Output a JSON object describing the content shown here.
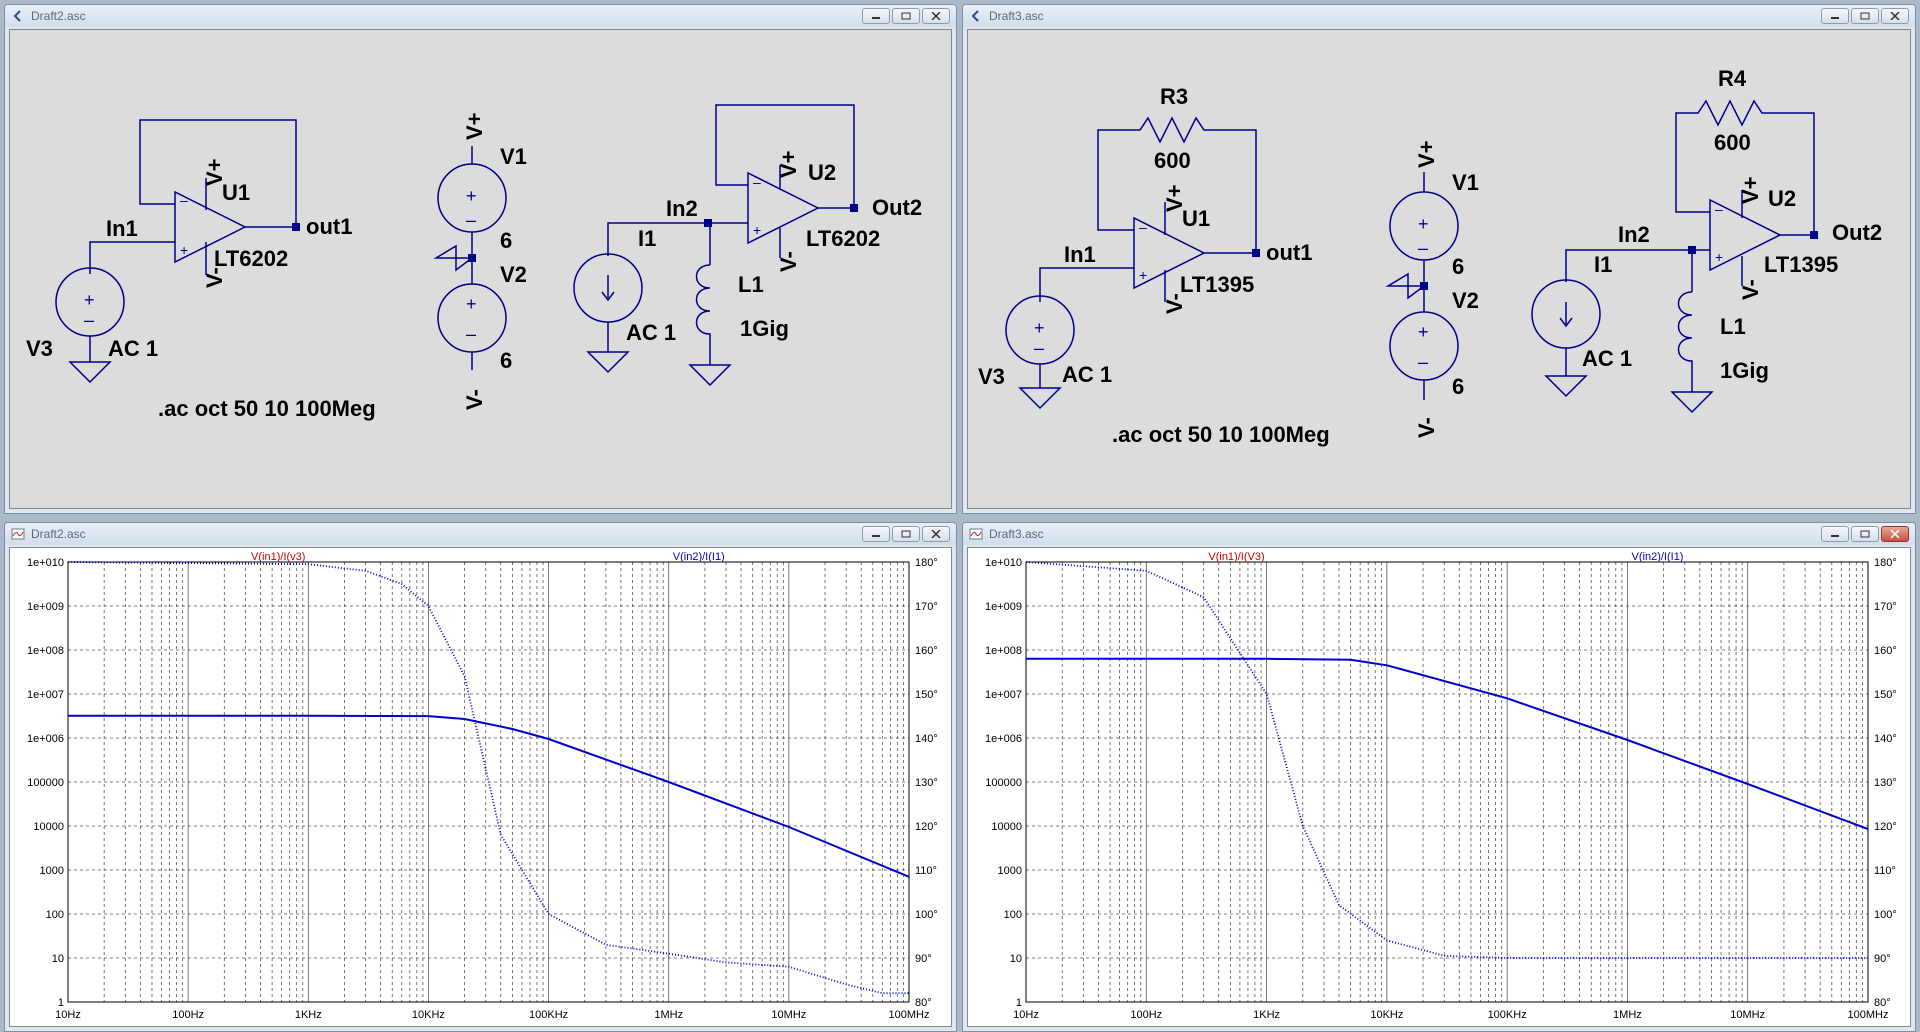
{
  "windows": {
    "draft2_schematic": {
      "title": "Draft2.asc"
    },
    "draft3_schematic": {
      "title": "Draft3.asc"
    },
    "draft2_plot": {
      "title": "Draft2.asc"
    },
    "draft3_plot": {
      "title": "Draft3.asc"
    }
  },
  "schematic2": {
    "u1_name": "U1",
    "u1_model": "LT6202",
    "u2_name": "U2",
    "u2_model": "LT6202",
    "in1": "In1",
    "out1": "out1",
    "in2": "In2",
    "out2": "Out2",
    "v1": "V1",
    "v2": "V2",
    "v3": "V3",
    "v1_value": "6",
    "v2_value": "6",
    "vplus": "V+",
    "vminus": "V-",
    "ac": "AC 1",
    "i1": "I1",
    "l1": "L1",
    "l1_value": "1Gig",
    "directive": ".ac oct 50 10 100Meg"
  },
  "schematic3": {
    "u1_name": "U1",
    "u1_model": "LT1395",
    "u2_name": "U2",
    "u2_model": "LT1395",
    "r3": "R3",
    "r3_value": "600",
    "r4": "R4",
    "r4_value": "600",
    "in1": "In1",
    "out1": "out1",
    "in2": "In2",
    "out2": "Out2",
    "v1": "V1",
    "v2": "V2",
    "v3": "V3",
    "v1_value": "6",
    "v2_value": "6",
    "vplus": "V+",
    "vminus": "V-",
    "ac": "AC 1",
    "i1": "I1",
    "l1": "L1",
    "l1_value": "1Gig",
    "directive": ".ac oct 50 10 100Meg"
  },
  "colors": {
    "trace": "#0000d0",
    "label_red": "#cc0000",
    "label_blue": "#0000cc",
    "grid": "#555555"
  },
  "chart_data": [
    {
      "type": "line",
      "x_scale": "log",
      "xlim": [
        10,
        100000000
      ],
      "ylim_left": [
        1,
        10000000000
      ],
      "ylim_right": [
        80,
        180
      ],
      "x_ticks": [
        "10Hz",
        "100Hz",
        "1KHz",
        "10KHz",
        "100KHz",
        "1MHz",
        "10MHz",
        "100MHz"
      ],
      "y_ticks_left": [
        "1",
        "10",
        "100",
        "1000",
        "10000",
        "100000",
        "1e+006",
        "1e+007",
        "1e+008",
        "1e+009",
        "1e+010"
      ],
      "y_ticks_right": [
        "80°",
        "90°",
        "100°",
        "110°",
        "120°",
        "130°",
        "140°",
        "150°",
        "160°",
        "170°",
        "180°"
      ],
      "grid": true,
      "series": [
        {
          "name": "V(in1)/I(v3)",
          "color": "#cc0000",
          "style": "solid",
          "axis": "left",
          "x": [
            10,
            1000,
            10000,
            20000,
            50000,
            100000,
            1000000,
            10000000,
            100000000
          ],
          "y": [
            3200000,
            3200000,
            3150000,
            2700000,
            1600000,
            950000,
            100000,
            9500,
            700
          ]
        },
        {
          "name": "V(in2)/I(I1)",
          "color": "#0000cc",
          "style": "dotted",
          "axis": "right",
          "x": [
            10,
            1000,
            3000,
            6000,
            10000,
            20000,
            40000,
            100000,
            300000,
            1000000,
            3000000,
            10000000,
            30000000,
            60000000,
            100000000
          ],
          "y": [
            180,
            179.5,
            178,
            175,
            170,
            154,
            118,
            100,
            93,
            91,
            89,
            88,
            84,
            82,
            82
          ]
        }
      ]
    },
    {
      "type": "line",
      "x_scale": "log",
      "xlim": [
        10,
        100000000
      ],
      "ylim_left": [
        1,
        10000000000
      ],
      "ylim_right": [
        80,
        180
      ],
      "x_ticks": [
        "10Hz",
        "100Hz",
        "1KHz",
        "10KHz",
        "100KHz",
        "1MHz",
        "10MHz",
        "100MHz"
      ],
      "y_ticks_left": [
        "1",
        "10",
        "100",
        "1000",
        "10000",
        "100000",
        "1e+006",
        "1e+007",
        "1e+008",
        "1e+009",
        "1e+010"
      ],
      "y_ticks_right": [
        "80°",
        "90°",
        "100°",
        "110°",
        "120°",
        "130°",
        "140°",
        "150°",
        "160°",
        "170°",
        "180°"
      ],
      "grid": true,
      "series": [
        {
          "name": "V(in1)/I(V3)",
          "color": "#cc0000",
          "style": "solid",
          "axis": "left",
          "x": [
            10,
            1000,
            5000,
            10000,
            100000,
            1000000,
            10000000,
            100000000
          ],
          "y": [
            63000000,
            63000000,
            60000000,
            45000000,
            8000000,
            900000,
            90000,
            8500
          ]
        },
        {
          "name": "V(in2)/I(I1)",
          "color": "#0000cc",
          "style": "dotted",
          "axis": "right",
          "x": [
            10,
            100,
            300,
            1000,
            2000,
            4000,
            10000,
            30000,
            100000,
            1000000,
            100000000
          ],
          "y": [
            180,
            178,
            172,
            150,
            120,
            102,
            94,
            90.5,
            90,
            90,
            90
          ]
        }
      ]
    }
  ]
}
